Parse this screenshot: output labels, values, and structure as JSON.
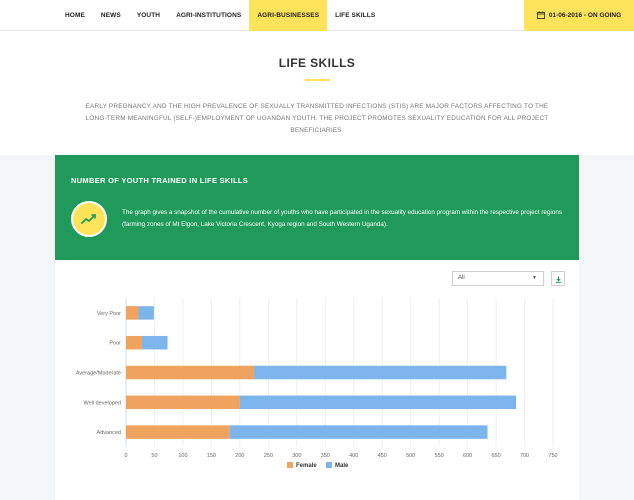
{
  "nav": {
    "items": [
      {
        "label": "HOME",
        "active": false
      },
      {
        "label": "NEWS",
        "active": false
      },
      {
        "label": "YOUTH",
        "active": false
      },
      {
        "label": "AGRI-INSTITUTIONS",
        "active": false
      },
      {
        "label": "AGRI-BUSINESSES",
        "active": true
      },
      {
        "label": "LIFE SKILLS",
        "active": false
      }
    ],
    "date_status": "01-06-2016 - ON GOING",
    "date_icon": "calendar-icon"
  },
  "page": {
    "title": "LIFE SKILLS",
    "intro": "EARLY PREGNANCY AND THE HIGH PREVALENCE OF SEXUALLY TRANSMITTED INFECTIONS (STIS) ARE MAJOR FACTORS AFFECTING TO THE LONG-TERM MEANINGFUL (SELF-)EMPLOYMENT OF UGANDAN YOUTH. THE PROJECT PROMOTES SEXUALITY EDUCATION FOR ALL PROJECT BENEFICIARIES."
  },
  "banner": {
    "title": "NUMBER OF YOUTH TRAINED IN LIFE SKILLS",
    "icon": "trend-line-icon",
    "text": "The graph gives a snapshot of the cumulative number of youths who have participated in the sexuality education program within the respective project regions (farming zones of Mt Elgon, Lake Victoria Crescent, Kyoga region and South Western Uganda)."
  },
  "controls": {
    "filter_selected": "All",
    "download_icon": "download-icon"
  },
  "colors": {
    "accent": "#fde35a",
    "banner": "#1f9a5a",
    "female": "#f0a35e",
    "male": "#7cb5ec"
  },
  "chart_data": {
    "type": "bar",
    "orientation": "horizontal",
    "stacked": true,
    "categories": [
      "Very Poor",
      "Poor",
      "Average/Moderate",
      "Well developed",
      "Advanced"
    ],
    "series": [
      {
        "name": "Female",
        "values": [
          22,
          28,
          225,
          200,
          182
        ]
      },
      {
        "name": "Male",
        "values": [
          27,
          45,
          443,
          485,
          453
        ]
      }
    ],
    "xlim": [
      0,
      750
    ],
    "xticks": [
      0,
      50,
      100,
      150,
      200,
      250,
      300,
      350,
      400,
      450,
      500,
      550,
      600,
      650,
      700,
      750
    ],
    "grid": true,
    "legend": "bottom-center"
  }
}
